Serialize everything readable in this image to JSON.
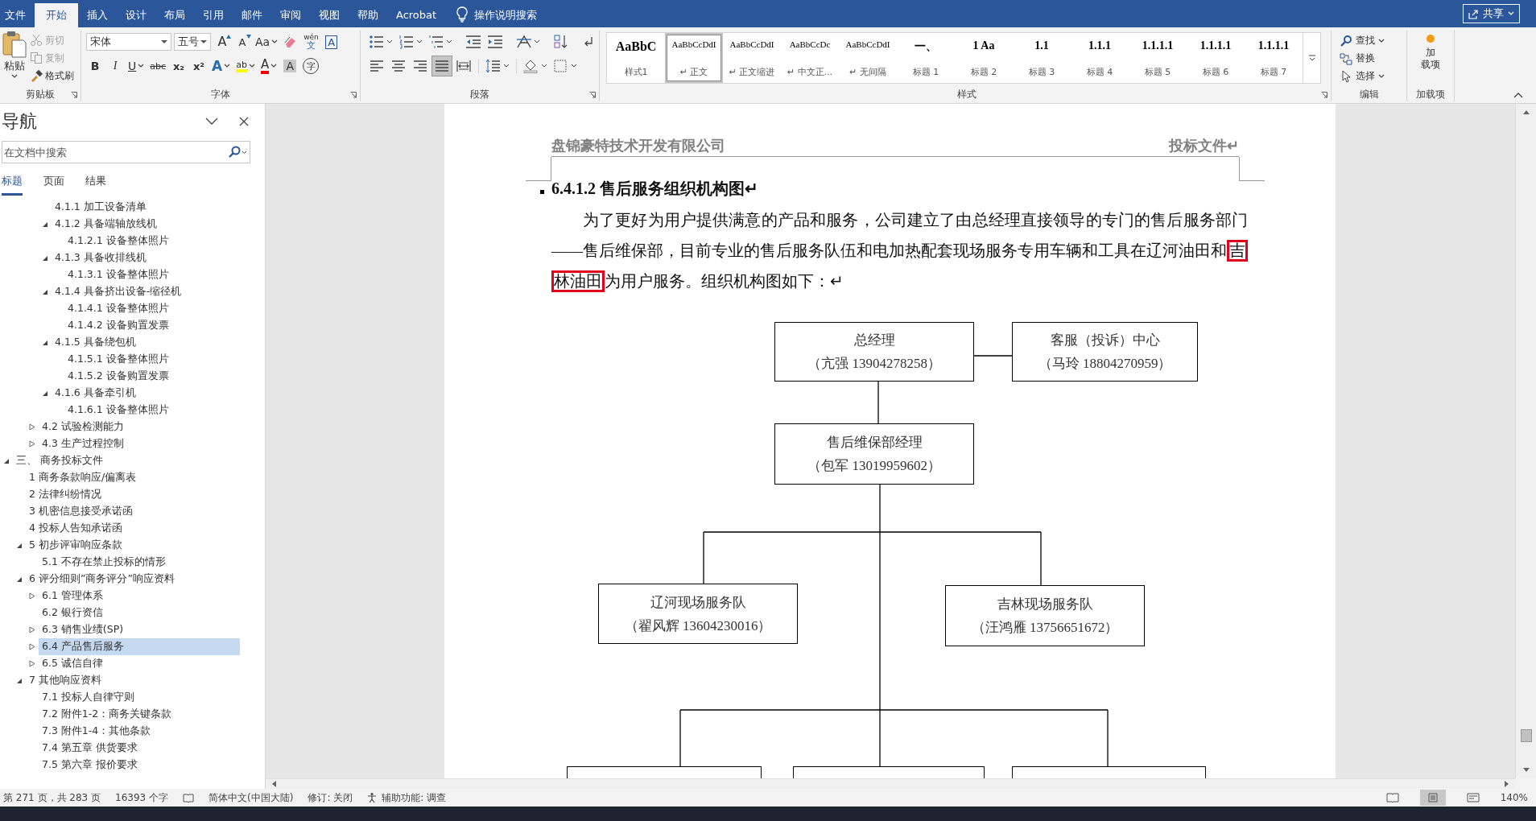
{
  "menu_tabs": [
    {
      "label": "文件",
      "selected": false
    },
    {
      "label": "开始",
      "selected": true
    },
    {
      "label": "插入",
      "selected": false
    },
    {
      "label": "设计",
      "selected": false
    },
    {
      "label": "布局",
      "selected": false
    },
    {
      "label": "引用",
      "selected": false
    },
    {
      "label": "邮件",
      "selected": false
    },
    {
      "label": "审阅",
      "selected": false
    },
    {
      "label": "视图",
      "selected": false
    },
    {
      "label": "帮助",
      "selected": false
    },
    {
      "label": "Acrobat",
      "selected": false
    }
  ],
  "tell_me": "操作说明搜索",
  "share_button": "共享",
  "clipboard": {
    "label": "剪贴板",
    "paste": "粘贴",
    "items": [
      {
        "kind": "cut",
        "label": "剪切",
        "disabled": true
      },
      {
        "kind": "copy",
        "label": "复制",
        "disabled": true
      },
      {
        "kind": "painter",
        "label": "格式刷",
        "disabled": false
      }
    ]
  },
  "font": {
    "label": "字体",
    "name": "宋体",
    "size": "五号",
    "row1": [
      {
        "kind": "grow",
        "glyph": "A",
        "dropdown": false
      },
      {
        "kind": "shrink",
        "glyph": "A",
        "dropdown": false
      },
      {
        "kind": "case",
        "glyph": "Aa",
        "dropdown": true
      },
      {
        "kind": "eraser",
        "dropdown": false
      },
      {
        "kind": "phonetic",
        "glyph": "wén",
        "sub_glyph": "文",
        "dropdown": false
      },
      {
        "kind": "boxed",
        "glyph": "A",
        "dropdown": false
      }
    ],
    "row2": [
      {
        "kind": "bold",
        "glyph": "B",
        "dropdown": false
      },
      {
        "kind": "italic",
        "glyph": "I",
        "dropdown": false
      },
      {
        "kind": "underline",
        "glyph": "U",
        "dropdown": true
      },
      {
        "kind": "strike",
        "glyph": "abc",
        "dropdown": false
      },
      {
        "kind": "sub",
        "glyph": "x₂",
        "dropdown": false
      },
      {
        "kind": "sup",
        "glyph": "x²",
        "dropdown": false
      },
      {
        "kind": "effect",
        "glyph": "A",
        "dropdown": true
      },
      {
        "kind": "highlight",
        "glyph": "ab",
        "dropdown": true
      },
      {
        "kind": "color",
        "glyph": "A",
        "dropdown": true
      },
      {
        "kind": "shaded",
        "glyph": "A",
        "dropdown": false
      },
      {
        "kind": "circled",
        "glyph": "字",
        "dropdown": false
      }
    ]
  },
  "paragraph": {
    "label": "段落",
    "align_buttons": [
      {
        "kind": "left",
        "selected": false
      },
      {
        "kind": "center",
        "selected": false
      },
      {
        "kind": "right",
        "selected": false
      },
      {
        "kind": "justify",
        "selected": true
      },
      {
        "kind": "distributed",
        "selected": false
      }
    ]
  },
  "styles": {
    "label": "样式",
    "items": [
      {
        "preview": "AaBbC",
        "label": "样式1",
        "kind": "big",
        "selected": false
      },
      {
        "preview": "AaBbCcDdI",
        "label": "↵ 正文",
        "kind": "body",
        "selected": true
      },
      {
        "preview": "AaBbCcDdI",
        "label": "↵ 正文缩进",
        "kind": "body",
        "selected": false
      },
      {
        "preview": "AaBbCcDc",
        "label": "↵ 中文正...",
        "kind": "body",
        "selected": false
      },
      {
        "preview": "AaBbCcDdI",
        "label": "↵ 无间隔",
        "kind": "body",
        "selected": false
      },
      {
        "preview": "一、",
        "label": "标题 1",
        "kind": "heading",
        "selected": false
      },
      {
        "preview": "1  Aa",
        "label": "标题 2",
        "kind": "heading",
        "selected": false
      },
      {
        "preview": "1.1",
        "label": "标题 3",
        "kind": "heading",
        "selected": false
      },
      {
        "preview": "1.1.1",
        "label": "标题 4",
        "kind": "heading",
        "selected": false
      },
      {
        "preview": "1.1.1.1",
        "label": "标题 5",
        "kind": "heading",
        "selected": false
      },
      {
        "preview": "1.1.1.1",
        "label": "标题 6",
        "kind": "heading",
        "selected": false
      },
      {
        "preview": "1.1.1.1",
        "label": "标题 7",
        "kind": "heading",
        "selected": false
      }
    ]
  },
  "editing": {
    "label": "编辑",
    "items": [
      {
        "kind": "find",
        "label": "查找",
        "dropdown": true
      },
      {
        "kind": "replace",
        "label": "替换",
        "dropdown": false
      },
      {
        "kind": "select",
        "label": "选择",
        "dropdown": true
      }
    ]
  },
  "addins": {
    "label": "加载项",
    "button_lines": [
      "加",
      "载项"
    ]
  },
  "nav": {
    "title": "导航",
    "search": {
      "placeholder": "在文档中搜索"
    },
    "tabs": [
      {
        "label": "标题",
        "selected": true
      },
      {
        "label": "页面",
        "selected": false
      },
      {
        "label": "结果",
        "selected": false
      }
    ],
    "tree": [
      {
        "children": [
          {
            "children": [
              {
                "children": [
                  {
                    "label": "4.1.1 加工设备清单",
                    "selected": false
                  },
                  {
                    "label": "4.1.2 具备端轴放线机",
                    "selected": false,
                    "expanded": true,
                    "children": [
                      {
                        "label": "4.1.2.1 设备整体照片",
                        "selected": false
                      }
                    ]
                  },
                  {
                    "label": "4.1.3 具备收排线机",
                    "selected": false,
                    "expanded": true,
                    "children": [
                      {
                        "label": "4.1.3.1 设备整体照片",
                        "selected": false
                      }
                    ]
                  },
                  {
                    "label": "4.1.4 具备挤出设备-缩径机",
                    "selected": false,
                    "expanded": true,
                    "children": [
                      {
                        "label": "4.1.4.1 设备整体照片",
                        "selected": false
                      },
                      {
                        "label": "4.1.4.2 设备购置发票",
                        "selected": false
                      }
                    ]
                  },
                  {
                    "label": "4.1.5 具备绕包机",
                    "selected": false,
                    "expanded": true,
                    "children": [
                      {
                        "label": "4.1.5.1 设备整体照片",
                        "selected": false
                      },
                      {
                        "label": "4.1.5.2 设备购置发票",
                        "selected": false
                      }
                    ]
                  },
                  {
                    "label": "4.1.6 具备牵引机",
                    "selected": false,
                    "expanded": true,
                    "children": [
                      {
                        "label": "4.1.6.1 设备整体照片",
                        "selected": false
                      }
                    ]
                  }
                ]
              },
              {
                "label": "4.2 试验检测能力",
                "selected": false,
                "expanded": false
              },
              {
                "label": "4.3 生产过程控制",
                "selected": false,
                "expanded": false
              }
            ]
          }
        ]
      },
      {
        "label": "三、 商务投标文件",
        "selected": false,
        "expanded": true,
        "children": [
          {
            "label": "1 商务条款响应/偏离表",
            "selected": false
          },
          {
            "label": "2 法律纠纷情况",
            "selected": false
          },
          {
            "label": "3 机密信息接受承诺函",
            "selected": false
          },
          {
            "label": "4 投标人告知承诺函",
            "selected": false
          },
          {
            "label": "5 初步评审响应条款",
            "selected": false,
            "expanded": true,
            "children": [
              {
                "label": "5.1 不存在禁止投标的情形",
                "selected": false
              }
            ]
          },
          {
            "label": "6 评分细则”商务评分”响应资料",
            "selected": false,
            "expanded": true,
            "children": [
              {
                "label": "6.1 管理体系",
                "selected": false,
                "expanded": false
              },
              {
                "label": "6.2 银行资信",
                "selected": false
              },
              {
                "label": "6.3 销售业绩(SP)",
                "selected": false,
                "expanded": false
              },
              {
                "label": "6.4 产品售后服务",
                "selected": true,
                "expanded": false
              },
              {
                "label": "6.5 诚信自律",
                "selected": false,
                "expanded": false
              }
            ]
          },
          {
            "label": "7 其他响应资料",
            "selected": false,
            "expanded": true,
            "children": [
              {
                "label": "7.1 投标人自律守则",
                "selected": false
              },
              {
                "label": "7.2 附件1-2：商务关键条款",
                "selected": false
              },
              {
                "label": "7.3 附件1-4：其他条款",
                "selected": false
              },
              {
                "label": "7.4 第五章  供货要求",
                "selected": false
              },
              {
                "label": "7.5 第六章  报价要求",
                "selected": false
              }
            ]
          }
        ]
      }
    ]
  },
  "document": {
    "header_left": "盘锦豪特技术开发有限公司",
    "header_right": "投标文件↵",
    "heading": "6.4.1.2 售后服务组织机构图↵",
    "paragraph_lines": [
      [
        {
          "text": "为了更好为用户提供满意的产品和服务，公司建立了由总经理直接领导的专门的售后服务部门",
          "highlighted": false
        }
      ],
      [
        {
          "text": "——售后维保部，目前专业的售后服务队伍和电加热配套现场服务专用车辆和工具在辽河油田和",
          "highlighted": false
        },
        {
          "text": "吉",
          "highlighted": true
        }
      ],
      [
        {
          "text": "林油田",
          "highlighted": true
        },
        {
          "text": "为用户服务。组织机构图如下：↵",
          "highlighted": false
        }
      ]
    ],
    "org_chart": [
      {
        "kind": "box",
        "title": "总经理",
        "contact": "（亢强  13904278258）"
      },
      {
        "kind": "box",
        "title": "客服（投诉）中心",
        "contact": "（马玲  18804270959）"
      },
      {
        "kind": "box",
        "title": "售后维保部经理",
        "contact": "（包军  13019959602）"
      },
      {
        "kind": "box",
        "title": "辽河现场服务队",
        "contact": "（翟风辉  13604230016）"
      },
      {
        "kind": "box",
        "title": "吉林现场服务队",
        "contact": "（汪鸿雁  13756651672）"
      },
      {
        "kind": "clipped"
      },
      {
        "kind": "clipped"
      },
      {
        "kind": "clipped"
      }
    ]
  },
  "status_bar": {
    "page": "第 271 页，共 283 页",
    "words": "16393 个字",
    "language": "简体中文(中国大陆)",
    "track_changes": "修订: 关闭",
    "accessibility": "辅助功能: 调查",
    "zoom": "140%",
    "views": [
      {
        "kind": "read",
        "selected": false
      },
      {
        "kind": "print",
        "selected": true
      },
      {
        "kind": "web",
        "selected": false
      }
    ]
  }
}
